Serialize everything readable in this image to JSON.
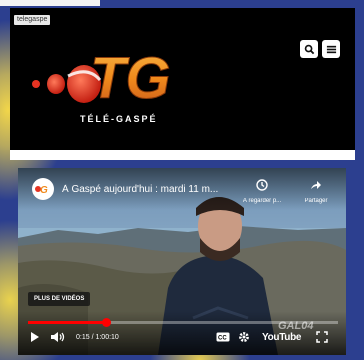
{
  "site": {
    "tag": "telegaspe"
  },
  "logo": {
    "letters": "TG",
    "wordmark": "TÉLÉ-GASPÉ"
  },
  "header": {
    "search_icon": "search-icon",
    "menu_icon": "menu-icon"
  },
  "video": {
    "title": "À Gaspé aujourd'hui : mardi 11 m...",
    "watch_later_label": "À regarder p...",
    "share_label": "Partager",
    "more_videos_label": "PLUS DE VIDÉOS",
    "time": "0:15 / 1:00:10",
    "youtube_label": "YouTube",
    "watermark": "GAL04",
    "progress": 0.25
  },
  "colors": {
    "background": "#2c3f8f",
    "logo_orange": "#f08a1c",
    "logo_red": "#e63322",
    "progress_red": "#ff0000"
  }
}
